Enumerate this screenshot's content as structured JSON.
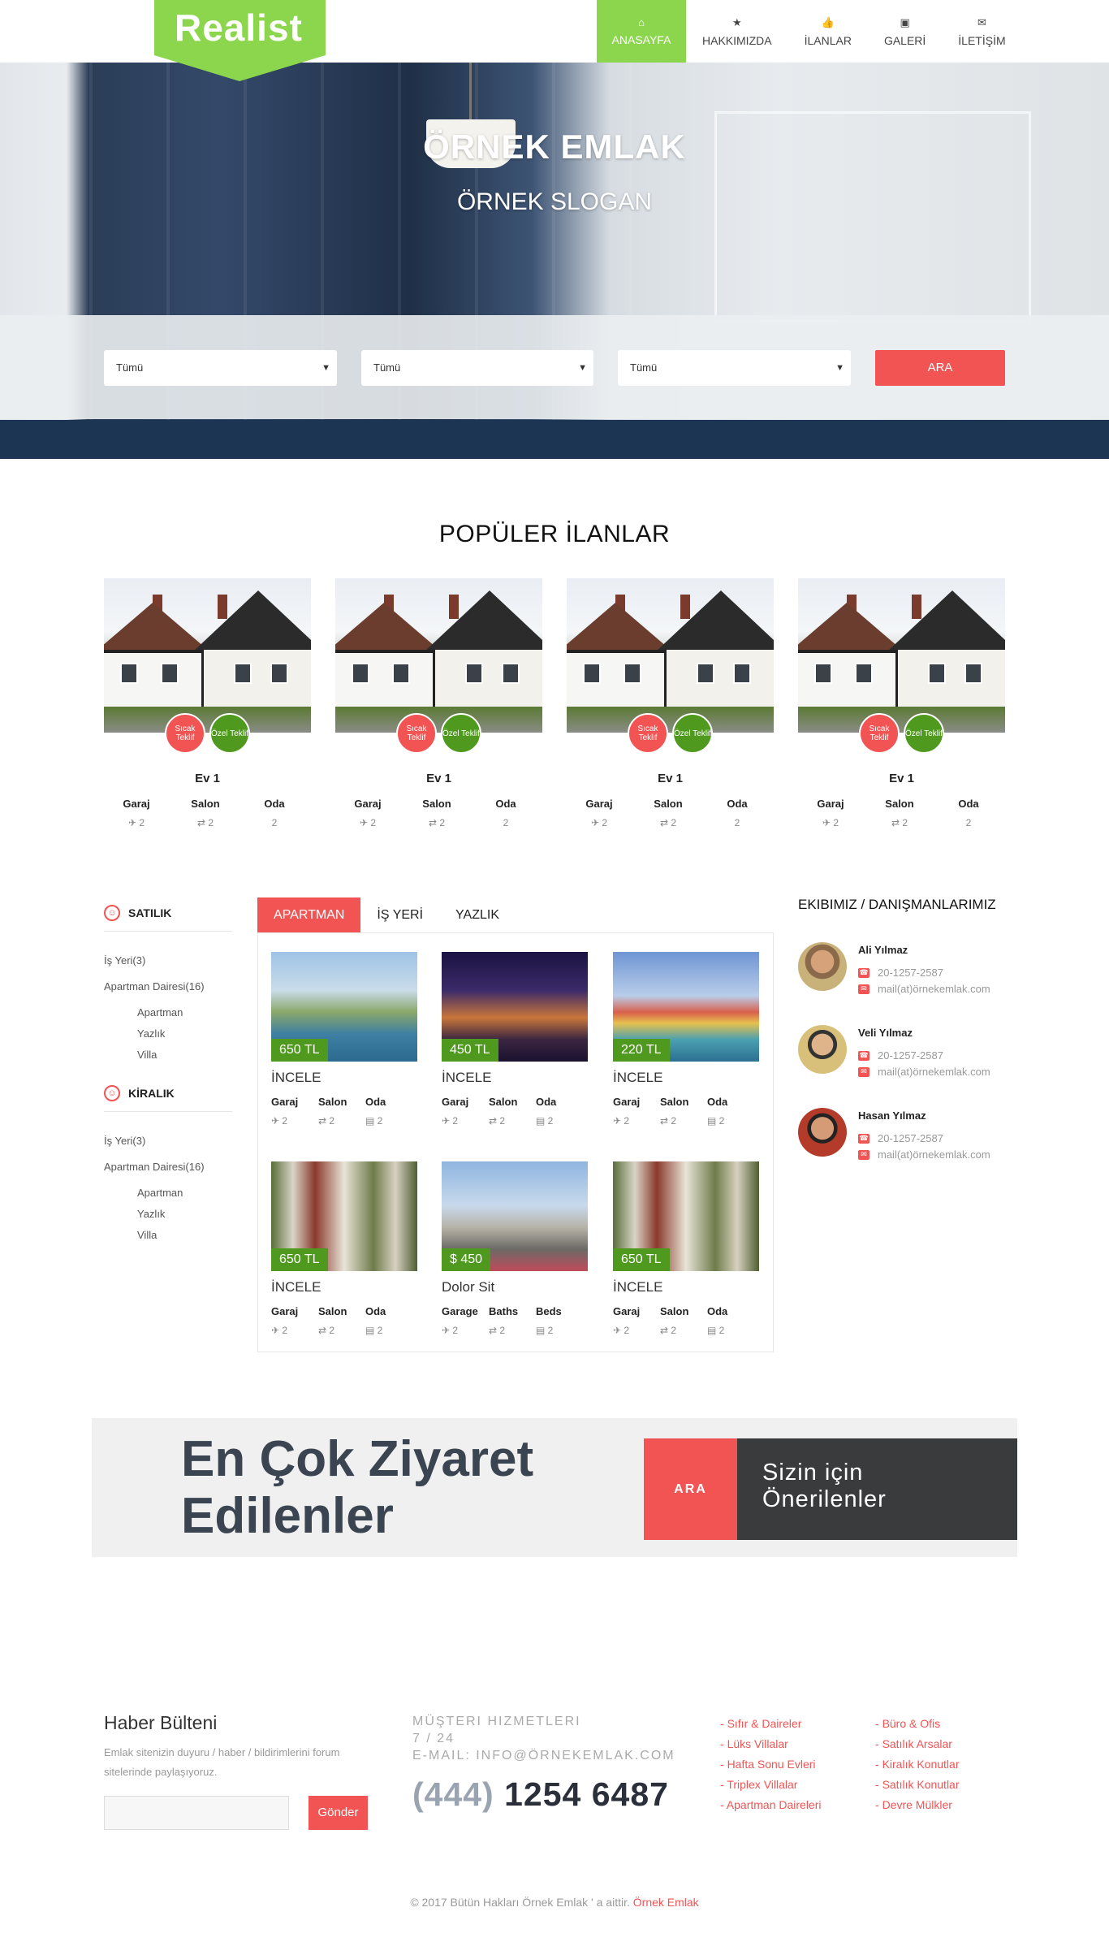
{
  "brand": {
    "logo_text": "Realist"
  },
  "nav": [
    {
      "label": "ANASAYFA",
      "icon": "home-icon",
      "glyph": "⌂",
      "active": true
    },
    {
      "label": "HAKKIMIZDA",
      "icon": "star-icon",
      "glyph": "★"
    },
    {
      "label": "İLANLAR",
      "icon": "thumbs-up-icon",
      "glyph": "👍"
    },
    {
      "label": "GALERİ",
      "icon": "image-icon",
      "glyph": "▣"
    },
    {
      "label": "İLETİŞİM",
      "icon": "envelope-icon",
      "glyph": "✉"
    }
  ],
  "hero": {
    "title": "ÖRNEK EMLAK",
    "slogan": "ÖRNEK SLOGAN"
  },
  "search": {
    "selects": [
      {
        "value": "Tümü"
      },
      {
        "value": "Tümü"
      },
      {
        "value": "Tümü"
      }
    ],
    "button": "ARA"
  },
  "popular": {
    "title": "POPÜLER İLANLAR",
    "badge_hot": "Sıcak Teklif",
    "badge_special": "Özel Teklif",
    "features": [
      "Garaj",
      "Salon",
      "Oda"
    ],
    "items": [
      {
        "name": "Ev 1",
        "values": [
          "2",
          "2",
          "2"
        ]
      },
      {
        "name": "Ev 1",
        "values": [
          "2",
          "2",
          "2"
        ]
      },
      {
        "name": "Ev 1",
        "values": [
          "2",
          "2",
          "2"
        ]
      },
      {
        "name": "Ev 1",
        "values": [
          "2",
          "2",
          "2"
        ]
      }
    ]
  },
  "sidebar": {
    "sections": [
      {
        "title": "SATILIK",
        "items": [
          "İş Yeri(3)",
          "Apartman Dairesi(16)"
        ],
        "sub": [
          "Apartman",
          "Yazlık",
          "Villa"
        ]
      },
      {
        "title": "KİRALIK",
        "items": [
          "İş Yeri(3)",
          "Apartman Dairesi(16)"
        ],
        "sub": [
          "Apartman",
          "Yazlık",
          "Villa"
        ]
      }
    ]
  },
  "tabs": [
    "APARTMAN",
    "İŞ YERİ",
    "YAZLIK"
  ],
  "listings": [
    {
      "price": "650 TL",
      "title": "İNCELE",
      "features": [
        "Garaj",
        "Salon",
        "Oda"
      ],
      "values": [
        "2",
        "2",
        "2"
      ],
      "scene": "harbor"
    },
    {
      "price": "450 TL",
      "title": "İNCELE",
      "features": [
        "Garaj",
        "Salon",
        "Oda"
      ],
      "values": [
        "2",
        "2",
        "2"
      ],
      "scene": "bridge"
    },
    {
      "price": "220 TL",
      "title": "İNCELE",
      "features": [
        "Garaj",
        "Salon",
        "Oda"
      ],
      "values": [
        "2",
        "2",
        "2"
      ],
      "scene": "colorful"
    },
    {
      "price": "650 TL",
      "title": "İNCELE",
      "features": [
        "Garaj",
        "Salon",
        "Oda"
      ],
      "values": [
        "2",
        "2",
        "2"
      ],
      "scene": "townhouse"
    },
    {
      "price": "$ 450",
      "title": "Dolor Sit",
      "features": [
        "Garage",
        "Baths",
        "Beds"
      ],
      "values": [
        "2",
        "2",
        "2"
      ],
      "scene": "street"
    },
    {
      "price": "650 TL",
      "title": "İNCELE",
      "features": [
        "Garaj",
        "Salon",
        "Oda"
      ],
      "values": [
        "2",
        "2",
        "2"
      ],
      "scene": "townhouse"
    }
  ],
  "team": {
    "title": "EKIBIMIZ / DANIŞMANLARIMIZ",
    "agents": [
      {
        "name": "Ali Yılmaz",
        "phone": "20-1257-2587",
        "email": "mail(at)örnekemlak.com"
      },
      {
        "name": "Veli Yılmaz",
        "phone": "20-1257-2587",
        "email": "mail(at)örnekemlak.com"
      },
      {
        "name": "Hasan Yılmaz",
        "phone": "20-1257-2587",
        "email": "mail(at)örnekemlak.com"
      }
    ]
  },
  "banner": {
    "line1": "En Çok Ziyaret",
    "line2": "Edilenler",
    "button": "ARA",
    "rec1": "Sizin için",
    "rec2": "Önerilenler"
  },
  "newsletter": {
    "title": "Haber Bülteni",
    "text": "Emlak sitenizin duyuru / haber / bildirimlerini forum sitelerinde paylaşıyoruz.",
    "button": "Gönder"
  },
  "contact": {
    "line1": "MÜŞTERI HIZMETLERI",
    "line2": "7 / 24",
    "line3": "E-MAIL: INFO@ÖRNEKEMLAK.COM",
    "phone_prefix": "(444)",
    "phone_number": "1254 6487"
  },
  "links_col1": [
    "Sıfır & Daireler",
    "Lüks Villalar",
    "Hafta Sonu Evleri",
    "Triplex Villalar",
    "Apartman Daireleri"
  ],
  "links_col2": [
    "Büro & Ofis",
    "Satılık Arsalar",
    "Kiralık Konutlar",
    "Satılık Konutlar",
    "Devre Mülkler"
  ],
  "footer": {
    "copyright": "© 2017 Bütün Hakları Örnek Emlak ' a aittir.",
    "brand": "Örnek Emlak"
  },
  "colors": {
    "accent_green": "#8cd64e",
    "accent_red": "#f25353",
    "price_green": "#4f9a1e",
    "banner_dark": "#3a3b3c"
  }
}
